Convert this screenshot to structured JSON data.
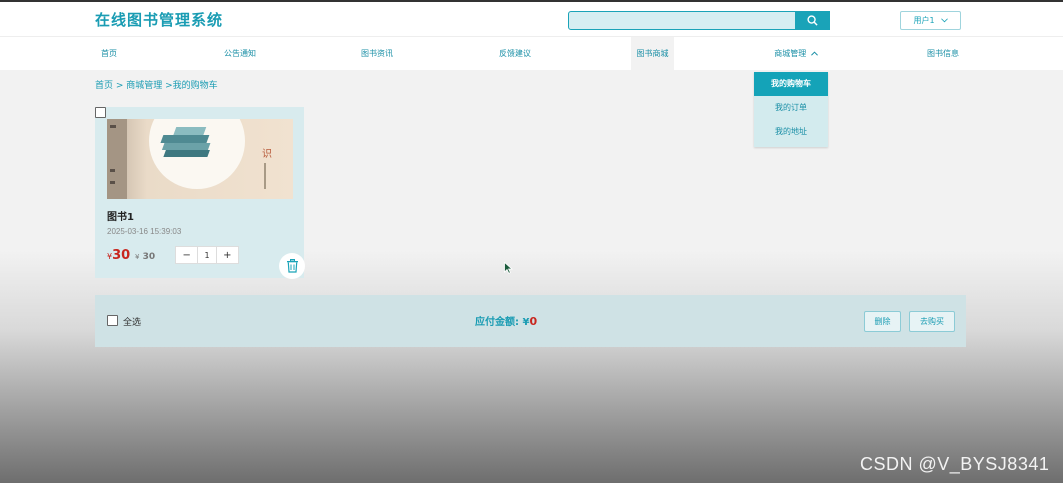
{
  "header": {
    "site_title": "在线图书管理系统",
    "search": {
      "value": "",
      "placeholder": ""
    },
    "user_label": "用户1"
  },
  "nav": {
    "items": [
      {
        "label": "首页"
      },
      {
        "label": "公告通知"
      },
      {
        "label": "图书资讯"
      },
      {
        "label": "反馈建议"
      },
      {
        "label": "图书商城"
      },
      {
        "label": "商城管理"
      },
      {
        "label": "图书信息"
      }
    ],
    "dropdown": [
      {
        "label": "我的购物车"
      },
      {
        "label": "我的订单"
      },
      {
        "label": "我的地址"
      }
    ]
  },
  "breadcrumb": "首页 > 商城管理 >我的购物车",
  "cart": {
    "item": {
      "name": "图书1",
      "date": "2025-03-16 15:39:03",
      "currency": "¥",
      "price": "30",
      "original_price": "30",
      "quantity": "1",
      "minus": "−",
      "plus": "+"
    },
    "select_all_label": "全选",
    "total_label": "应付金额: ¥",
    "total_value": "0",
    "delete_label": "删除",
    "checkout_label": "去购买"
  },
  "watermark": "CSDN @V_BYSJ8341",
  "colors": {
    "accent": "#1aa3b8",
    "price": "#c8261e",
    "card_bg": "#d8ebee"
  }
}
